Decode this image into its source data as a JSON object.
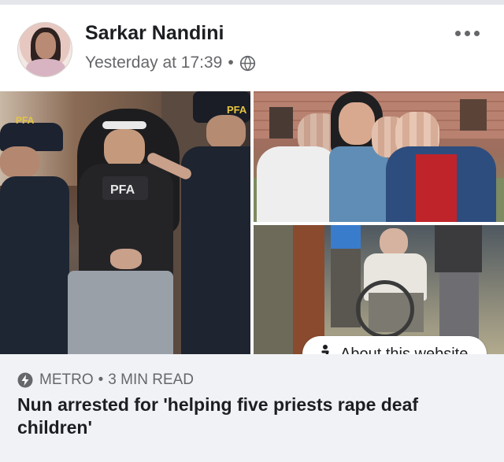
{
  "post": {
    "author_name": "Sarkar Nandini",
    "timestamp": "Yesterday at 17:39",
    "separator": "•",
    "privacy_icon": "globe-icon",
    "more_icon": "more-options-icon"
  },
  "media": {
    "vest_label_left": "PFA",
    "vest_label_center": "PFA",
    "vest_label_right": "PFA",
    "about_label": "About this website",
    "about_icon": "info-icon"
  },
  "link_preview": {
    "source": "METRO",
    "read_time": "3 MIN READ",
    "source_icon": "bolt-icon",
    "headline": "Nun arrested for 'helping five priests rape deaf children'"
  },
  "colors": {
    "text_primary": "#1c1e21",
    "text_secondary": "#65676b",
    "preview_bg": "#f0f2f5"
  }
}
